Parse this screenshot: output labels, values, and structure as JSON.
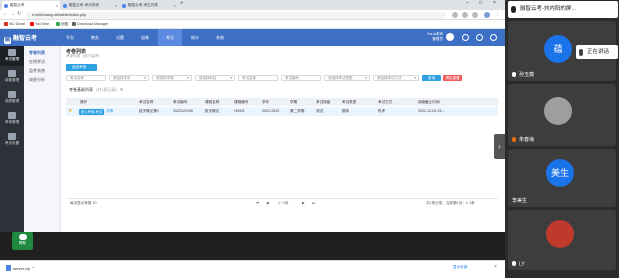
{
  "browser": {
    "tabs": [
      {
        "label": "融智云考"
      },
      {
        "label": "融智云考-考试系统"
      },
      {
        "label": "融智云考-考生列表"
      }
    ],
    "new_tab": "+",
    "url": "e.rzhichuang.net/admin/index.php",
    "bookmarks": [
      {
        "label": "MC Gmail",
        "color": "#d93025"
      },
      {
        "label": "YouTube",
        "color": "#ff0000"
      },
      {
        "label": "地图",
        "color": "#34a853"
      },
      {
        "label": "Download Manager",
        "color": "#5f6368"
      }
    ],
    "downloads": {
      "file": "server.zip",
      "show_all": "显示全部",
      "close": "×"
    }
  },
  "app": {
    "brand": "融智云考",
    "brand_logo": "融",
    "nav": [
      {
        "label": "平台"
      },
      {
        "label": "教务"
      },
      {
        "label": "试题"
      },
      {
        "label": "组卷"
      },
      {
        "label": "考试"
      },
      {
        "label": "统计"
      },
      {
        "label": "系统"
      }
    ],
    "active_nav": 4,
    "user": {
      "line1": "Da.ai老师",
      "line2": "管理员"
    },
    "sidebar": [
      {
        "label": "考试管理"
      },
      {
        "label": "阅卷管理"
      },
      {
        "label": "成绩管理"
      },
      {
        "label": "考场管理"
      },
      {
        "label": "考试设置"
      }
    ],
    "submenu": [
      {
        "label": "考卷列表"
      },
      {
        "label": "在线考试"
      },
      {
        "label": "监考系统"
      },
      {
        "label": "成绩分析"
      }
    ],
    "page": {
      "title": "考卷列表",
      "subtitle": "考卷列表（线下监考）",
      "return_button": "返回考卷",
      "filters": [
        {
          "placeholder": "考试名称",
          "select": false
        },
        {
          "placeholder": "请选择学年",
          "select": true
        },
        {
          "placeholder": "请选择学期",
          "select": true
        },
        {
          "placeholder": "请选择科目",
          "select": true
        },
        {
          "placeholder": "考试名称",
          "select": false
        },
        {
          "placeholder": "考试编号",
          "select": false
        },
        {
          "placeholder": "请选择考试类型",
          "select": true
        },
        {
          "placeholder": "请选择考试方式",
          "select": true
        }
      ],
      "query_button": "查询",
      "reset_button": "清除重置",
      "list_heading": "考卷基础列表",
      "list_count": "(共1条记录)",
      "columns": [
        "操作",
        "考试名称",
        "考试编号",
        "课程名称",
        "课程编号",
        "学年",
        "学期",
        "考试班级",
        "考试类型",
        "考试方式",
        "阅卷截止时间"
      ],
      "rows": [
        {
          "op_button": "进入考场-考试",
          "op_link": "详情",
          "cells": [
            "航天概论第1",
            "2022120106",
            "航天概论",
            "H0001",
            "2022-2023",
            "第二学期",
            "测试",
            "期末",
            "机考",
            "2022-12-01 23:..."
          ]
        }
      ],
      "pager": {
        "per_page": "每页显示条数 10",
        "first": "⏮",
        "prev": "◀",
        "page_info": "1 / 1页",
        "next": "▶",
        "last": "⏭",
        "summary": "共1条记录，当前第1页：1-1条"
      }
    },
    "chat_widget": "帮助"
  },
  "meeting": {
    "top_bar": "融智云考-刘内阳的屏...",
    "speaking": "正在讲话",
    "participants": [
      {
        "name": "孙玉蕴",
        "avatar": "蕴",
        "avatar_color": "#1a73e8"
      },
      {
        "name": "朱春海",
        "avatar": "",
        "avatar_color": "#e8710a"
      },
      {
        "name": "李美生",
        "avatar": "美生",
        "avatar_color": "#1a73e8"
      },
      {
        "name": "LY",
        "avatar": "",
        "avatar_color": "#c0392b"
      }
    ],
    "collapse": "›"
  }
}
